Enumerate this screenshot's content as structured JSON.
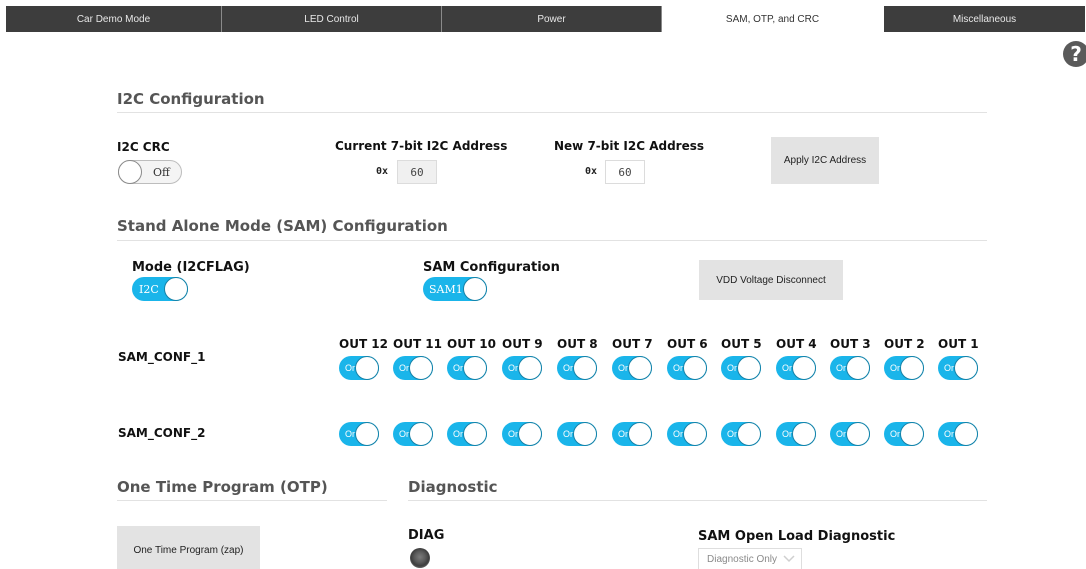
{
  "tabs": [
    {
      "label": "Car Demo Mode"
    },
    {
      "label": "LED Control"
    },
    {
      "label": "Power"
    },
    {
      "label": "SAM, OTP, and CRC"
    },
    {
      "label": "Miscellaneous"
    }
  ],
  "help": {
    "glyph": "?"
  },
  "i2c": {
    "title": "I2C Configuration",
    "crc_label": "I2C CRC",
    "crc_toggle": "Off",
    "current_label": "Current 7-bit I2C Address",
    "current_prefix": "0x",
    "current_value": "60",
    "new_label": "New 7-bit I2C Address",
    "new_prefix": "0x",
    "new_value": "60",
    "apply_button": "Apply I2C Address"
  },
  "sam": {
    "title": "Stand Alone Mode (SAM) Configuration",
    "mode_label": "Mode (I2CFLAG)",
    "mode_toggle": "I2C",
    "config_label": "SAM Configuration",
    "config_toggle": "SAM1",
    "vdd_button": "VDD Voltage Disconnect",
    "outputs": [
      "OUT 12",
      "OUT 11",
      "OUT 10",
      "OUT 9",
      "OUT 8",
      "OUT 7",
      "OUT 6",
      "OUT 5",
      "OUT 4",
      "OUT 3",
      "OUT 2",
      "OUT 1"
    ],
    "conf1_label": "SAM_CONF_1",
    "conf1_states": [
      "On",
      "On",
      "On",
      "On",
      "On",
      "On",
      "On",
      "On",
      "On",
      "On",
      "On",
      "On"
    ],
    "conf2_label": "SAM_CONF_2",
    "conf2_states": [
      "On",
      "On",
      "On",
      "On",
      "On",
      "On",
      "On",
      "On",
      "On",
      "On",
      "On",
      "On"
    ]
  },
  "otp": {
    "title": "One Time Program (OTP)",
    "button": "One Time Program (zap)"
  },
  "diagnostic": {
    "title": "Diagnostic",
    "diag_label": "DIAG",
    "open_load_label": "SAM Open Load Diagnostic",
    "open_load_value": "Diagnostic Only"
  },
  "colors": {
    "toggle_on": "#1ab5ea",
    "tab_bg": "#3d3d3d",
    "section_title": "#555555"
  }
}
